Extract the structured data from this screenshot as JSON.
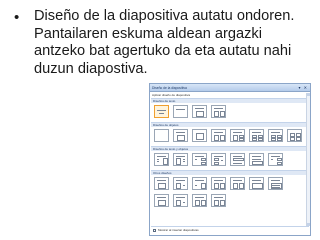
{
  "slide": {
    "bullet": "•",
    "text": "Diseño de la diapositiva autatu ondoren. Pantailaren eskuma aldean argazki antzeko bat agertuko da eta autatu nahi duzun diapostiva."
  },
  "task_pane": {
    "title": "Diseño de la diapositiva",
    "header_buttons": "▾ ✕",
    "subtitle": "Aplicar diseño de diapositiva",
    "sections": [
      {
        "label": "Diseños de texto"
      },
      {
        "label": "Diseños de objetos"
      },
      {
        "label": "Diseños de texto y objetos"
      },
      {
        "label": "Otros diseños"
      }
    ],
    "footer_checkbox_label": "Mostrar al insertar diapositivas",
    "colors": {
      "header": "#b4cbea",
      "border": "#8ba5c8",
      "selected": "#f0a030"
    }
  }
}
